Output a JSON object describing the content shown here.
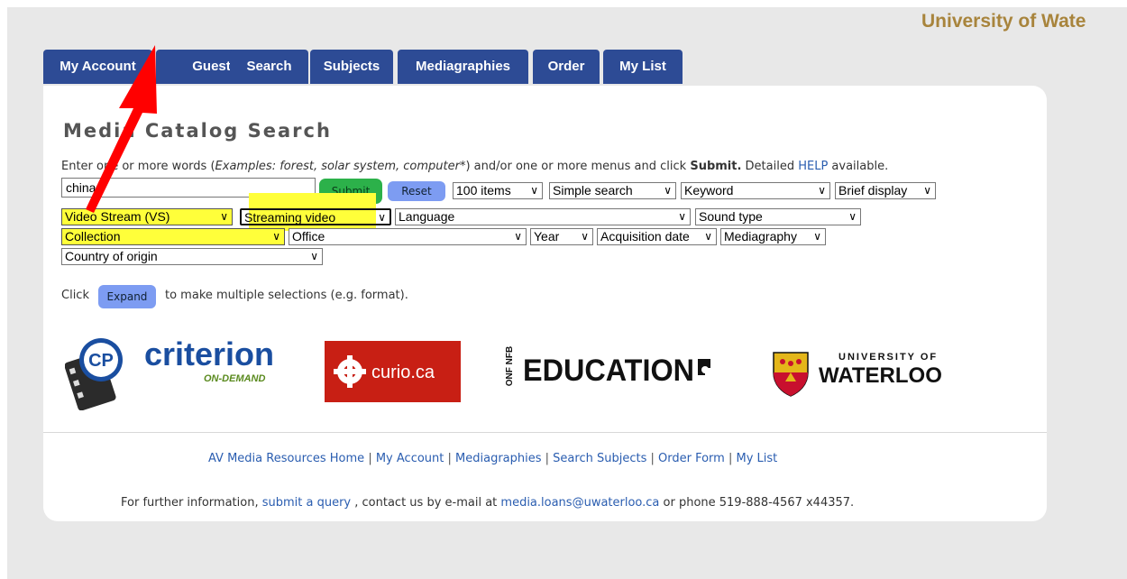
{
  "university_title": "University of Wate",
  "tabs": [
    {
      "label": "My Account"
    },
    {
      "label": "Guest"
    },
    {
      "label": "Search"
    },
    {
      "label": "Subjects"
    },
    {
      "label": "Mediagraphies"
    },
    {
      "label": "Order"
    },
    {
      "label": "My List"
    }
  ],
  "panel": {
    "heading": "Media Catalog Search",
    "instructions": {
      "intro": "Enter one or more words (",
      "examples": "Examples: forest, solar system, computer",
      "after_examples": "*) and/or one or more menus and click ",
      "submit_word": "Submit.",
      "detailed": " Detailed ",
      "help": "HELP",
      "available": " available."
    },
    "search_input": {
      "value": "china"
    },
    "submit_label": "Submit",
    "reset_label": "Reset",
    "selects": {
      "items": "100 items",
      "search_mode": "Simple search",
      "field": "Keyword",
      "display": "Brief display",
      "format": "Video Stream (VS)",
      "media_type": "Streaming video",
      "language": "Language",
      "sound": "Sound type",
      "collection": "Collection",
      "office": "Office",
      "year": "Year",
      "acquisition": "Acquisition date",
      "mediagraphy": "Mediagraphy",
      "country": "Country of origin"
    },
    "click_text": "Click",
    "expand_label": "Expand",
    "expand_suffix": "to make multiple selections (e.g. format).",
    "logos": {
      "criterion_name": "criterion",
      "criterion_sub": "ON-DEMAND",
      "curio": "curio.ca",
      "education": "EDUCATION",
      "nfb": "ONF NFB",
      "uw_top": "UNIVERSITY OF",
      "uw_bottom": "WATERLOO"
    },
    "footer": {
      "links": [
        "AV Media Resources Home",
        "My Account",
        "Mediagraphies",
        "Search Subjects",
        "Order Form",
        "My List"
      ],
      "separator": " | ",
      "info_prefix": "For further information, ",
      "query_link": "submit a query",
      "info_mid": " , contact us by e-mail at ",
      "email": "media.loans@uwaterloo.ca",
      "info_suffix": " or phone 519-888-4567 x44357."
    }
  },
  "colors": {
    "tab_bg": "#2d4b95",
    "title_gold": "#a8843c",
    "highlight": "#ffff3a",
    "arrow": "#ff0000",
    "link": "#2a5db0"
  }
}
